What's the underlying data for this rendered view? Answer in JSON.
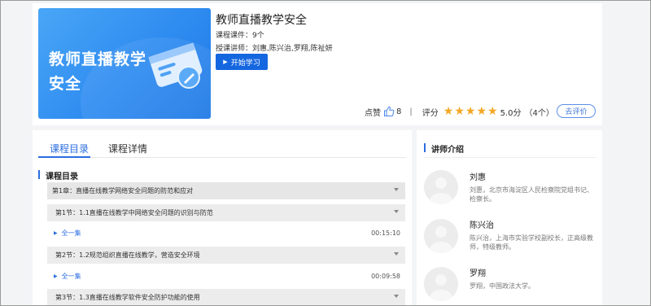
{
  "course": {
    "cover_title": "教师直播教学安全",
    "title": "教师直播教学安全",
    "count": "课程课件：9个",
    "lecturers": "授课讲师：刘惠,陈兴治,罗翔,陈祉妍",
    "start_button": "开始学习"
  },
  "stats": {
    "likes_label": "点赞",
    "likes_count": "8",
    "separator": "|",
    "rating_label": "评分",
    "stars": 5,
    "score": "5.0分",
    "rating_count": "（4个）",
    "rate_button": "去评价",
    "star_color": "#f5a623"
  },
  "tabs": [
    "课程目录",
    "课程详情"
  ],
  "catalog": {
    "title": "课程目录",
    "chapter": "第1章：直播在线教学网络安全问题的防范和应对",
    "rows": [
      {
        "kind": "section",
        "text": "第1节：1.1直播在线教学中网络安全问题的识别与防范"
      },
      {
        "kind": "item",
        "text": "全一集",
        "duration": "00:15:10"
      },
      {
        "kind": "section",
        "text": "第2节：1.2规范组织直播在线教学，营造安全环境"
      },
      {
        "kind": "item",
        "text": "全一集",
        "duration": "00:09:58"
      },
      {
        "kind": "section",
        "text": "第3节：1.3直播在线教学软件安全防护功能的使用"
      }
    ]
  },
  "lecturers_panel": {
    "title": "讲师介绍",
    "items": [
      {
        "name": "刘惠",
        "desc": "刘惠，北京市海淀区人民检察院党组书记、检察长。"
      },
      {
        "name": "陈兴治",
        "desc": "陈兴治，上海市实验学校副校长，正高级教师，特级教师。"
      },
      {
        "name": "罗翔",
        "desc": "罗翔，中国政法大学。"
      }
    ]
  },
  "colors": {
    "accent": "#2b6de0",
    "button": "#1567e0",
    "cover": "#2f8cf0"
  }
}
